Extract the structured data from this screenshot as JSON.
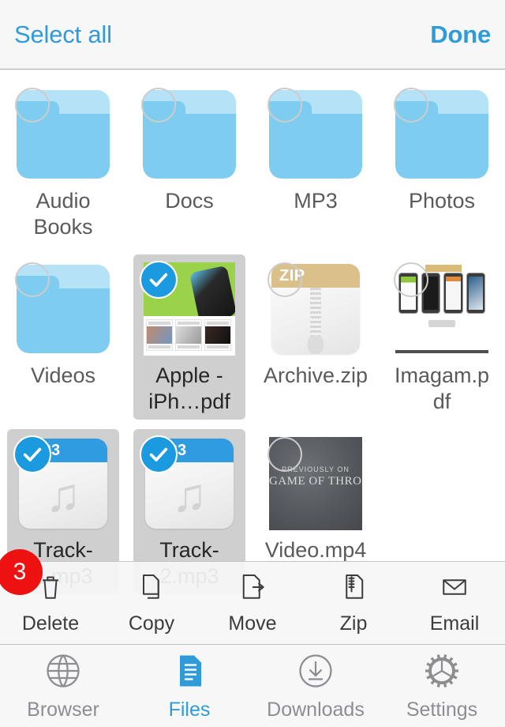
{
  "header": {
    "select_all_label": "Select all",
    "done_label": "Done"
  },
  "grid": {
    "rows": [
      [
        {
          "name": "Audio Books",
          "kind": "folder",
          "selected": false
        },
        {
          "name": "Docs",
          "kind": "folder",
          "selected": false
        },
        {
          "name": "MP3",
          "kind": "folder",
          "selected": false
        },
        {
          "name": "Photos",
          "kind": "folder",
          "selected": false
        }
      ],
      [
        {
          "name": "Videos",
          "kind": "folder",
          "selected": false
        },
        {
          "name": "Apple - iPh…pdf",
          "kind": "pdf-apple",
          "selected": true
        },
        {
          "name": "Archive.zip",
          "kind": "zip",
          "selected": false,
          "badge": "ZIP"
        },
        {
          "name": "Imagam.pdf",
          "kind": "pdf-imagam",
          "selected": false
        }
      ],
      [
        {
          "name": "Track-1.mp3",
          "kind": "mp3",
          "selected": true,
          "badge": "MP3"
        },
        {
          "name": "Track-2.mp3",
          "kind": "mp3",
          "selected": true,
          "badge": "MP3"
        },
        {
          "name": "Video.mp4",
          "kind": "video",
          "selected": false,
          "video_overline": "PREVIOUSLY ON",
          "video_title": "GAME OF THRONES"
        }
      ]
    ]
  },
  "action_toolbar": {
    "selected_count": "3",
    "actions": [
      {
        "label": "Delete",
        "icon": "trash-icon"
      },
      {
        "label": "Copy",
        "icon": "copy-icon"
      },
      {
        "label": "Move",
        "icon": "move-icon"
      },
      {
        "label": "Zip",
        "icon": "zip-icon"
      },
      {
        "label": "Email",
        "icon": "envelope-icon"
      }
    ]
  },
  "tab_bar": {
    "tabs": [
      {
        "label": "Browser",
        "icon": "globe-icon",
        "active": false
      },
      {
        "label": "Files",
        "icon": "document-icon",
        "active": true
      },
      {
        "label": "Downloads",
        "icon": "download-icon",
        "active": false
      },
      {
        "label": "Settings",
        "icon": "gear-icon",
        "active": false
      }
    ]
  },
  "colors": {
    "accent": "#2f9bd8",
    "selection_blue": "#1c9ae0",
    "badge_red": "#ee1111",
    "folder_blue": "#7ecdf0",
    "zip_band": "#dcc08a"
  }
}
